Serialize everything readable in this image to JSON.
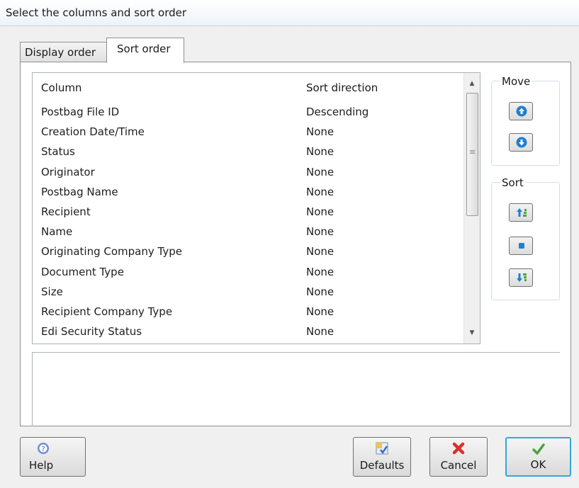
{
  "window": {
    "title": "Select the columns and sort order"
  },
  "tabs": [
    {
      "label": "Display order",
      "active": false
    },
    {
      "label": "Sort order",
      "active": true
    }
  ],
  "list": {
    "headers": {
      "column": "Column",
      "direction": "Sort direction"
    },
    "rows": [
      {
        "column": "Postbag File ID",
        "direction": "Descending"
      },
      {
        "column": "Creation Date/Time",
        "direction": "None"
      },
      {
        "column": "Status",
        "direction": "None"
      },
      {
        "column": "Originator",
        "direction": "None"
      },
      {
        "column": "Postbag Name",
        "direction": "None"
      },
      {
        "column": "Recipient",
        "direction": "None"
      },
      {
        "column": "Name",
        "direction": "None"
      },
      {
        "column": "Originating Company Type",
        "direction": "None"
      },
      {
        "column": "Document Type",
        "direction": "None"
      },
      {
        "column": "Size",
        "direction": "None"
      },
      {
        "column": "Recipient Company Type",
        "direction": "None"
      },
      {
        "column": "Edi Security Status",
        "direction": "None"
      }
    ]
  },
  "groups": {
    "move": {
      "label": "Move",
      "buttons": [
        "move-up-icon",
        "move-down-icon"
      ]
    },
    "sort": {
      "label": "Sort",
      "buttons": [
        "sort-ascending-icon",
        "sort-none-icon",
        "sort-descending-icon"
      ]
    }
  },
  "footer": {
    "help": "Help",
    "defaults": "Defaults",
    "cancel": "Cancel",
    "ok": "OK"
  },
  "colors": {
    "accent": "#39a4d8",
    "icon_blue": "#1f7fd1",
    "ok_green": "#4aa63a",
    "cancel_red": "#d8322a"
  }
}
